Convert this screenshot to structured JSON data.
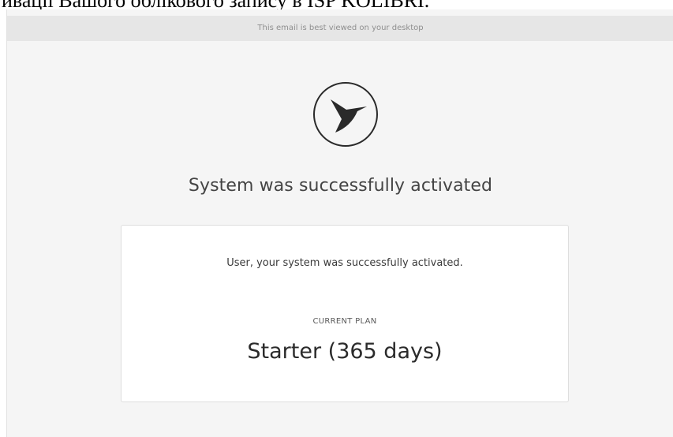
{
  "document": {
    "header_text": "ивації Вашого облікового запису в ISP KOLIBRI."
  },
  "email": {
    "topbar_text": "This email is best viewed on your desktop",
    "logo_icon": "hummingbird-icon",
    "headline": "System was successfully activated",
    "card": {
      "message": "User, your system was successfully activated.",
      "plan_label": "CURRENT PLAN",
      "plan_value": "Starter (365 days)"
    }
  },
  "colors": {
    "page_bg": "#f5f5f5",
    "topbar_bg": "#e6e6e6",
    "card_bg": "#ffffff",
    "logo_stroke": "#2a2a2a"
  }
}
